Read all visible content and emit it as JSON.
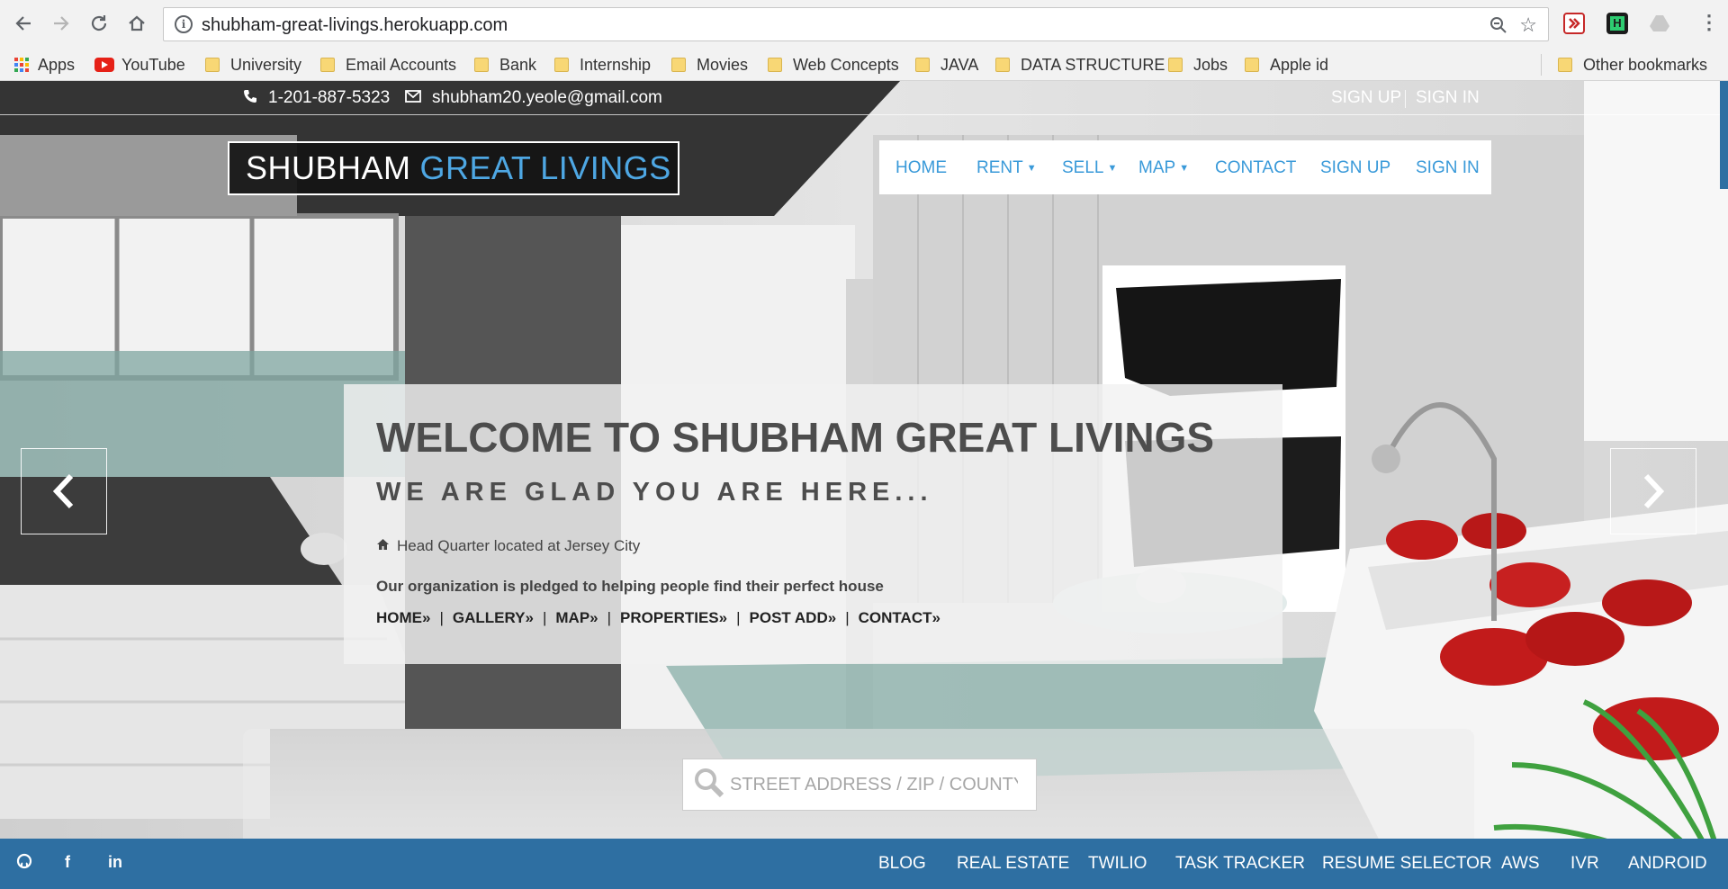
{
  "browser": {
    "url": "shubham-great-livings.herokuapp.com",
    "bookmarks": [
      "Apps",
      "YouTube",
      "University",
      "Email Accounts",
      "Bank",
      "Internship",
      "Movies",
      "Web Concepts",
      "JAVA",
      "DATA STRUCTURE",
      "Jobs",
      "Apple id"
    ],
    "other_bookmarks": "Other bookmarks",
    "icons": [
      "back-icon",
      "forward-icon",
      "reload-icon",
      "home-icon",
      "info-icon",
      "zoom-icon",
      "star-icon",
      "menu-icon"
    ]
  },
  "topbar": {
    "phone": "1-201-887-5323",
    "email": "shubham20.yeole@gmail.com",
    "sign_up": "SIGN UP",
    "sign_in": "SIGN IN"
  },
  "logo": {
    "part1": "SHUBHAM",
    "part2": "GREAT LIVINGS",
    "accent_color": "#4ea7e3"
  },
  "nav": {
    "home": "HOME",
    "rent": "RENT",
    "sell": "SELL",
    "map": "MAP",
    "contact": "CONTACT",
    "sign_up": "SIGN UP",
    "sign_in": "SIGN IN"
  },
  "welcome": {
    "title": "WELCOME TO SHUBHAM GREAT LIVINGS",
    "subtitle": "WE ARE GLAD YOU ARE HERE...",
    "hq": "Head Quarter located at Jersey City",
    "pledge": "Our organization is pledged to helping people find their perfect house",
    "links": [
      "HOME",
      "GALLERY",
      "MAP",
      "PROPERTIES",
      "POST ADD",
      "CONTACT"
    ]
  },
  "search": {
    "placeholder": "STREET ADDRESS / ZIP / COUNTY"
  },
  "footer": {
    "links": [
      "BLOG",
      "REAL ESTATE",
      "TWILIO",
      "TASK TRACKER",
      "RESUME SELECTOR",
      "AWS",
      "IVR",
      "ANDROID"
    ],
    "bar_color": "#2e6fa2"
  }
}
